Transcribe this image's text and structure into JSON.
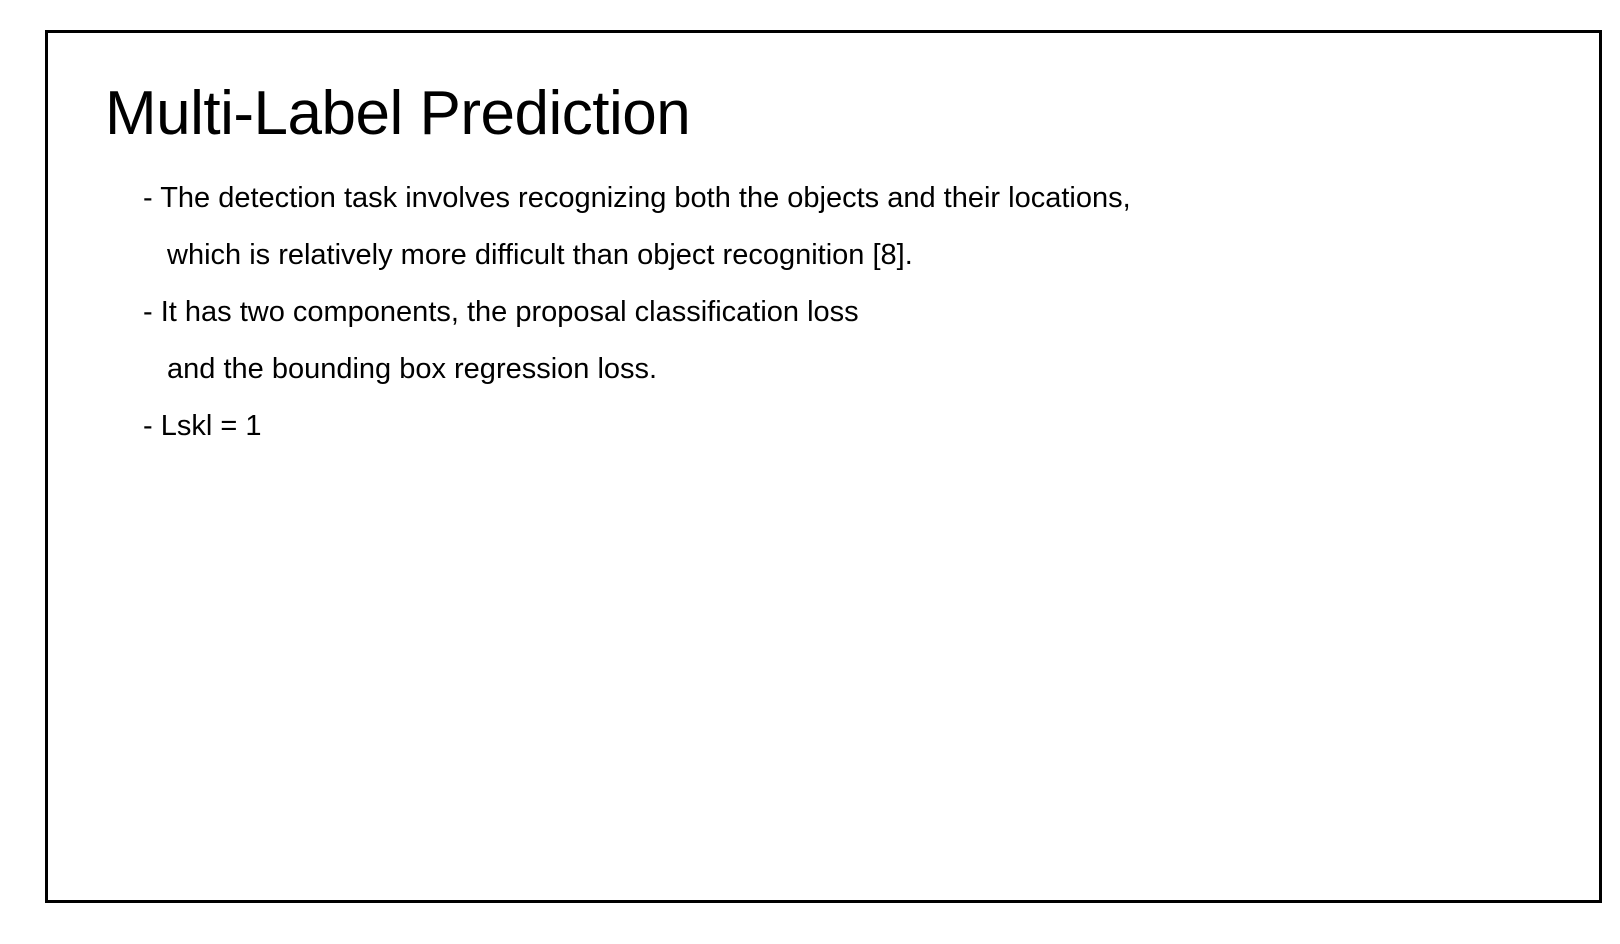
{
  "slide": {
    "title": "Multi-Label Prediction",
    "lines": [
      "- The detection task involves recognizing both the objects and their locations,",
      "which is relatively more difficult than object recognition [8].",
      "- It has two components, the proposal classification loss",
      "and the bounding box regression loss.",
      "- Lskl = 1"
    ]
  }
}
